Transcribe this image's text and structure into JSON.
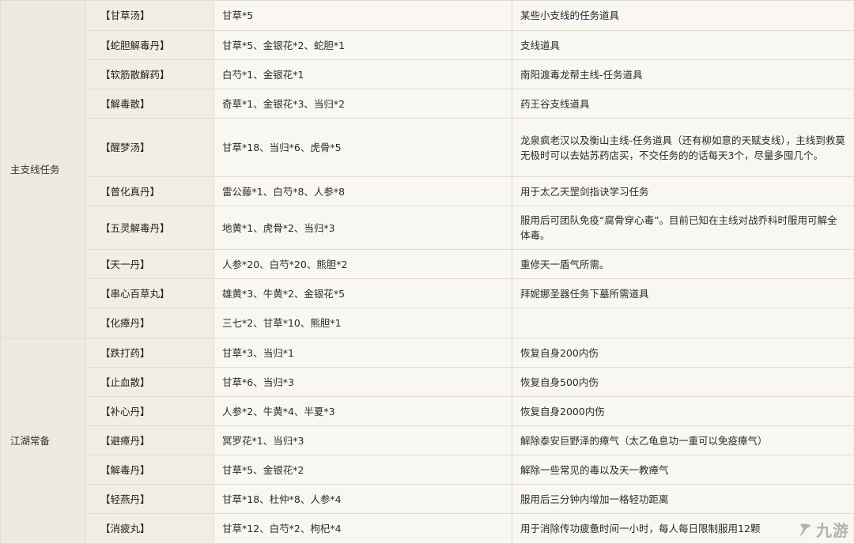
{
  "categories": [
    {
      "name": "主支线任务",
      "rows": [
        {
          "name": "【甘草汤】",
          "ingredients": "甘草*5",
          "use": "某些小支线的任务道具"
        },
        {
          "name": "【蛇胆解毒丹】",
          "ingredients": "甘草*5、金银花*2、蛇胆*1",
          "use": "支线道具"
        },
        {
          "name": "【软筋散解药】",
          "ingredients": "白芍*1、金银花*1",
          "use": "南阳渡毒龙帮主线-任务道具"
        },
        {
          "name": "【解毒散】",
          "ingredients": "奇草*1、金银花*3、当归*2",
          "use": "药王谷支线道具"
        },
        {
          "name": "【醒梦汤】",
          "ingredients": "甘草*18、当归*6、虎骨*5",
          "use": "龙泉疯老汉以及衡山主线-任务道具（还有柳如意的天赋支线），主线到救莫无极时可以去姑苏药店买，不交任务的的话每天3个，尽量多囤几个。"
        },
        {
          "name": "【普化真丹】",
          "ingredients": "雷公藤*1、白芍*8、人参*8",
          "use": "用于太乙天罡剑指诀学习任务"
        },
        {
          "name": "【五灵解毒丹】",
          "ingredients": "地黄*1、虎骨*2、当归*3",
          "use": "服用后可团队免疫“腐骨穿心毒”。目前已知在主线对战乔科时服用可解全体毒。"
        },
        {
          "name": "【天一丹】",
          "ingredients": "人参*20、白芍*20、熊胆*2",
          "use": "重修天一盾气所需。"
        },
        {
          "name": "【串心百草丸】",
          "ingredients": "雄黄*3、牛黄*2、金银花*5",
          "use": "拜妮娜圣器任务下墓所需道具"
        },
        {
          "name": "【化瘴丹】",
          "ingredients": "三七*2、甘草*10、熊胆*1",
          "use": ""
        }
      ]
    },
    {
      "name": "江湖常备",
      "rows": [
        {
          "name": "【跌打药】",
          "ingredients": "甘草*3、当归*1",
          "use": "恢复自身200内伤"
        },
        {
          "name": "【止血散】",
          "ingredients": "甘草*6、当归*3",
          "use": "恢复自身500内伤"
        },
        {
          "name": "【补心丹】",
          "ingredients": "人参*2、牛黄*4、半夏*3",
          "use": "恢复自身2000内伤"
        },
        {
          "name": "【避瘴丹】",
          "ingredients": "冥罗花*1、当归*3",
          "use": "解除泰安巨野泽的瘴气（太乙龟息功一重可以免疫瘴气）"
        },
        {
          "name": "【解毒丹】",
          "ingredients": "甘草*5、金银花*2",
          "use": "解除一些常见的毒以及天一教瘴气"
        },
        {
          "name": "【轻燕丹】",
          "ingredients": "甘草*18、杜仲*8、人参*4",
          "use": "服用后三分钟内增加一格轻功距离"
        },
        {
          "name": "【消疲丸】",
          "ingredients": "甘草*12、白芍*2、枸杞*4",
          "use": "用于消除传功疲惫时间一小时，每人每日限制服用12颗"
        }
      ]
    }
  ],
  "watermark": {
    "icon": "九游-logo-icon",
    "text": "九游"
  }
}
